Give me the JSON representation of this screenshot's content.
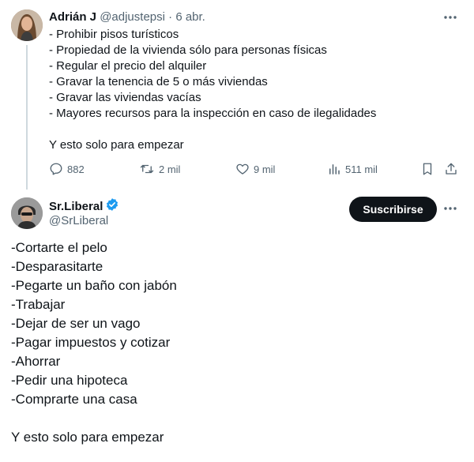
{
  "tweet1": {
    "author_name": "Adrián J",
    "author_handle": "@adjustepsi",
    "separator": " · ",
    "date": "6 abr.",
    "lines": [
      "- Prohibir pisos turísticos",
      "- Propiedad de la vivienda sólo para personas físicas",
      "- Regular el precio del alquiler",
      "- Gravar la tenencia de 5 o más viviendas",
      "- Gravar las viviendas vacías",
      "- Mayores recursos para la inspección en caso de ilegalidades"
    ],
    "closing": "Y esto solo para empezar",
    "replies": "882",
    "retweets": "2 mil",
    "likes": "9 mil",
    "views": "511 mil"
  },
  "tweet2": {
    "author_name": "Sr.Liberal",
    "author_handle": "@SrLiberal",
    "subscribe_label": "Suscribirse",
    "lines": [
      "-Cortarte el pelo",
      "-Desparasitarte",
      "-Pegarte un baño con jabón",
      "-Trabajar",
      "-Dejar de ser un vago",
      "-Pagar impuestos y cotizar",
      "-Ahorrar",
      "-Pedir una hipoteca",
      "-Comprarte una casa"
    ],
    "closing": "Y esto solo para empezar"
  },
  "icons": {
    "reply": "reply-icon",
    "retweet": "retweet-icon",
    "like": "heart-icon",
    "views": "views-icon",
    "bookmark": "bookmark-icon",
    "share": "share-icon",
    "more": "more-icon",
    "verified": "verified-badge-icon"
  },
  "colors": {
    "text": "#0f1419",
    "secondary": "#536471",
    "verified": "#1d9bf0",
    "button_bg": "#0f1419",
    "thread_line": "#cfd9de"
  }
}
